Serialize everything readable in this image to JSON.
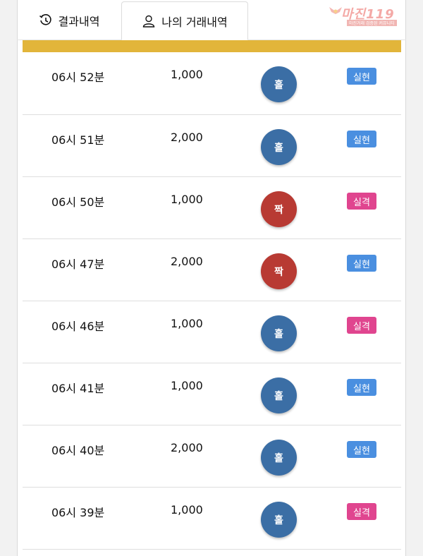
{
  "tabs": [
    {
      "label": "결과내역",
      "icon": "history-icon"
    },
    {
      "label": "나의 거래내역",
      "icon": "user-icon",
      "active": true
    }
  ],
  "logo": {
    "main": "마진",
    "suffix": "119",
    "sub": "마진거래 검증된 커뮤니티"
  },
  "colors": {
    "gold": "#e2b53a",
    "odd_ball": "#3b6ea5",
    "even_ball": "#b83a33",
    "success_badge": "#4a8fe0",
    "fail_badge": "#e0458f"
  },
  "records": [
    {
      "time": "06시 52분",
      "amount": "1,000",
      "pick": "홀",
      "result": "실현"
    },
    {
      "time": "06시 51분",
      "amount": "2,000",
      "pick": "홀",
      "result": "실현"
    },
    {
      "time": "06시 50분",
      "amount": "1,000",
      "pick": "짝",
      "result": "실격"
    },
    {
      "time": "06시 47분",
      "amount": "2,000",
      "pick": "짝",
      "result": "실현"
    },
    {
      "time": "06시 46분",
      "amount": "1,000",
      "pick": "홀",
      "result": "실격"
    },
    {
      "time": "06시 41분",
      "amount": "1,000",
      "pick": "홀",
      "result": "실현"
    },
    {
      "time": "06시 40분",
      "amount": "2,000",
      "pick": "홀",
      "result": "실현"
    },
    {
      "time": "06시 39분",
      "amount": "1,000",
      "pick": "홀",
      "result": "실격"
    }
  ]
}
